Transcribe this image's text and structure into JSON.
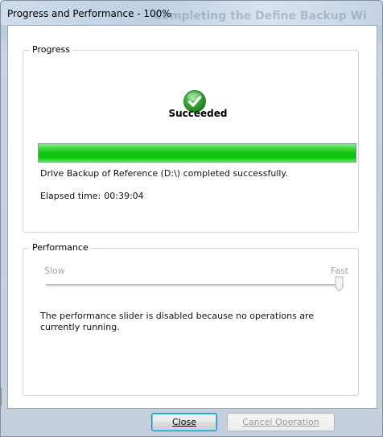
{
  "window": {
    "title": "Progress and Performance - 100%",
    "ghost_title": "Completing the Define Backup Wi"
  },
  "progress": {
    "group_label": "Progress",
    "status_icon": "check-circle-icon",
    "status_text": "Succeeded",
    "percent": 100,
    "message": "Drive Backup of Reference (D:\\) completed successfully.",
    "elapsed_label": "Elapsed time:",
    "elapsed_value": "00:39:04"
  },
  "performance": {
    "group_label": "Performance",
    "slow_label": "Slow",
    "fast_label": "Fast",
    "slider_value": 1.0,
    "slider_enabled": false,
    "note": "The performance slider is disabled because no operations are currently running."
  },
  "buttons": {
    "close_label": "Close",
    "cancel_label": "Cancel Operation"
  },
  "colors": {
    "progress_fill": "#14c914",
    "check_green": "#3aa63a",
    "disabled_text": "#a6a6a6"
  }
}
